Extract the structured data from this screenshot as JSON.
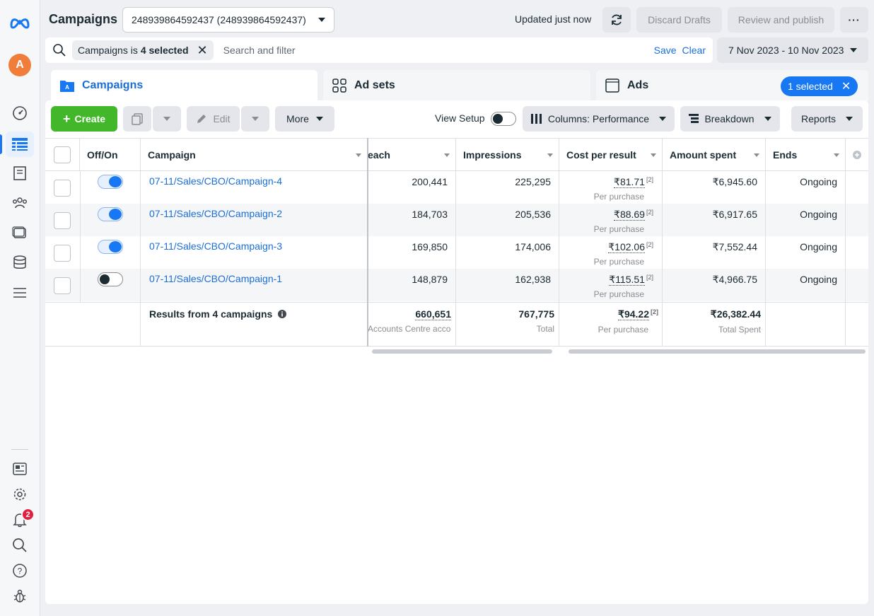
{
  "header": {
    "title": "Campaigns",
    "account_select": "248939864592437 (248939864592437)",
    "updated": "Updated just now",
    "discard": "Discard Drafts",
    "review": "Review and publish",
    "more": "···"
  },
  "search": {
    "chip_prefix": "Campaigns is",
    "chip_value": "4 selected",
    "placeholder": "Search and filter",
    "save": "Save",
    "clear": "Clear",
    "date_range": "7 Nov 2023 - 10 Nov 2023"
  },
  "tabs": {
    "campaigns": "Campaigns",
    "adsets": "Ad sets",
    "ads": "Ads",
    "selected_pill": "1 selected"
  },
  "toolbar": {
    "create": "Create",
    "edit": "Edit",
    "more": "More",
    "view_setup": "View Setup",
    "columns": "Columns: Performance",
    "breakdown": "Breakdown",
    "reports": "Reports"
  },
  "columns": {
    "offon": "Off/On",
    "campaign": "Campaign",
    "reach": "each",
    "impressions": "Impressions",
    "cpr": "Cost per result",
    "spent": "Amount spent",
    "ends": "Ends"
  },
  "rows": [
    {
      "name": "07-11/Sales/CBO/Campaign-4",
      "on": true,
      "reach": "200,441",
      "impressions": "225,295",
      "cpr": "₹81.71",
      "cpr_sup": "[2]",
      "cpr_sub": "Per purchase",
      "spent": "₹6,945.60",
      "ends": "Ongoing"
    },
    {
      "name": "07-11/Sales/CBO/Campaign-2",
      "on": true,
      "reach": "184,703",
      "impressions": "205,536",
      "cpr": "₹88.69",
      "cpr_sup": "[2]",
      "cpr_sub": "Per purchase",
      "spent": "₹6,917.65",
      "ends": "Ongoing"
    },
    {
      "name": "07-11/Sales/CBO/Campaign-3",
      "on": true,
      "reach": "169,850",
      "impressions": "174,006",
      "cpr": "₹102.06",
      "cpr_sup": "[2]",
      "cpr_sub": "Per purchase",
      "spent": "₹7,552.44",
      "ends": "Ongoing"
    },
    {
      "name": "07-11/Sales/CBO/Campaign-1",
      "on": false,
      "reach": "148,879",
      "impressions": "162,938",
      "cpr": "₹115.51",
      "cpr_sup": "[2]",
      "cpr_sub": "Per purchase",
      "spent": "₹4,966.75",
      "ends": "Ongoing"
    }
  ],
  "totals": {
    "label": "Results from 4 campaigns",
    "reach": "660,651",
    "reach_sub": "Accounts Centre acco...",
    "impressions": "767,775",
    "impressions_sub": "Total",
    "cpr": "₹94.22",
    "cpr_sup": "[2]",
    "cpr_sub": "Per purchase",
    "spent": "₹26,382.44",
    "spent_sub": "Total Spent"
  },
  "rail": {
    "avatar": "A",
    "notifications": "2"
  },
  "colors": {
    "accent": "#1877f2",
    "create": "#42b72a",
    "link": "#1a6ed8"
  }
}
